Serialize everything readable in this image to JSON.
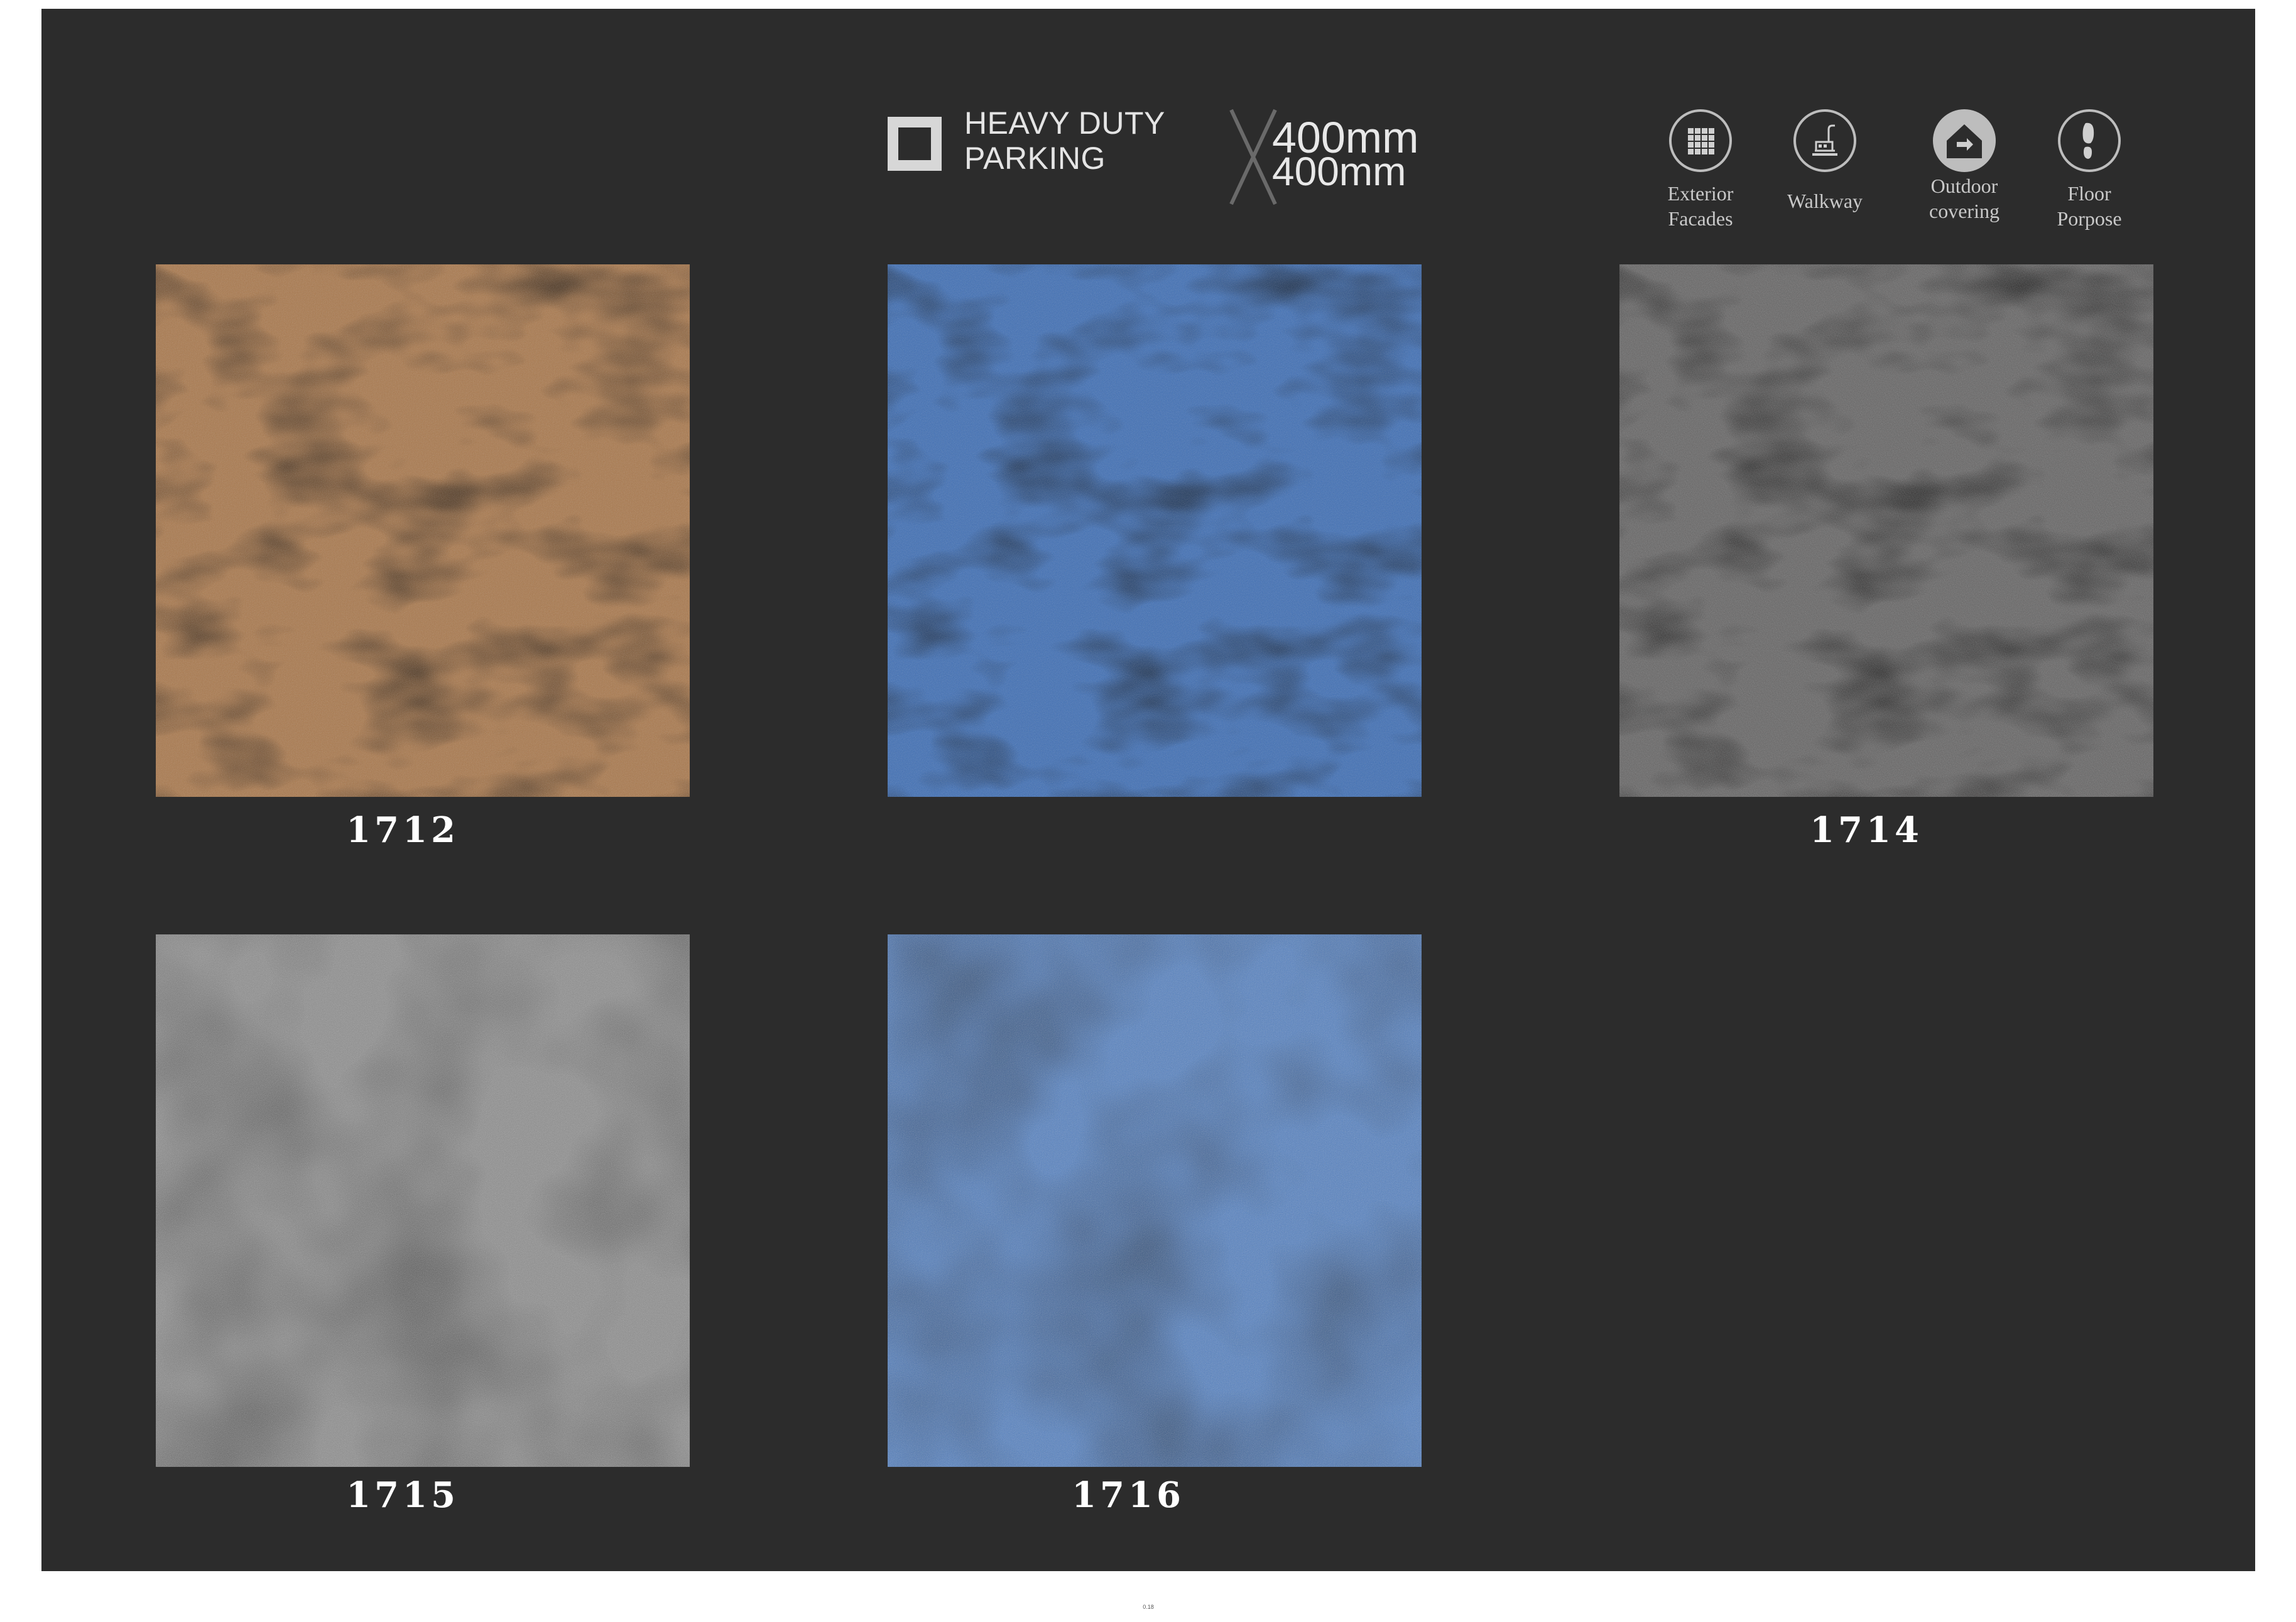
{
  "header": {
    "category_lines": [
      "HEAVY DUTY",
      "PARKING"
    ],
    "size": {
      "width": "400mm",
      "height": "400mm",
      "separator_icon": "x-cross-icon"
    },
    "usages": [
      {
        "icon": "grid-icon",
        "label": "Exterior\nFacades"
      },
      {
        "icon": "walkway-icon",
        "label": "Walkway"
      },
      {
        "icon": "outdoor-house-icon",
        "label": "Outdoor\ncovering"
      },
      {
        "icon": "footprint-icon",
        "label": "Floor\nPorpose"
      }
    ]
  },
  "tiles": [
    {
      "code": "1712",
      "color": "#a9774a",
      "shade": "#7e5634"
    },
    {
      "code": "",
      "color": "#3c6db5",
      "shade": "#234b86"
    },
    {
      "code": "1714",
      "color": "#636262",
      "shade": "#3f3f3e"
    },
    {
      "code": "1715",
      "color": "#8a8a8a",
      "shade": "#6a6a6a"
    },
    {
      "code": "1716",
      "color": "#4f7ec2",
      "shade": "#2f5a9a"
    }
  ],
  "colors": {
    "panel_background": "#2c2c2c",
    "page_background": "#ffffff"
  },
  "footer": {
    "page_number": "0.18"
  }
}
